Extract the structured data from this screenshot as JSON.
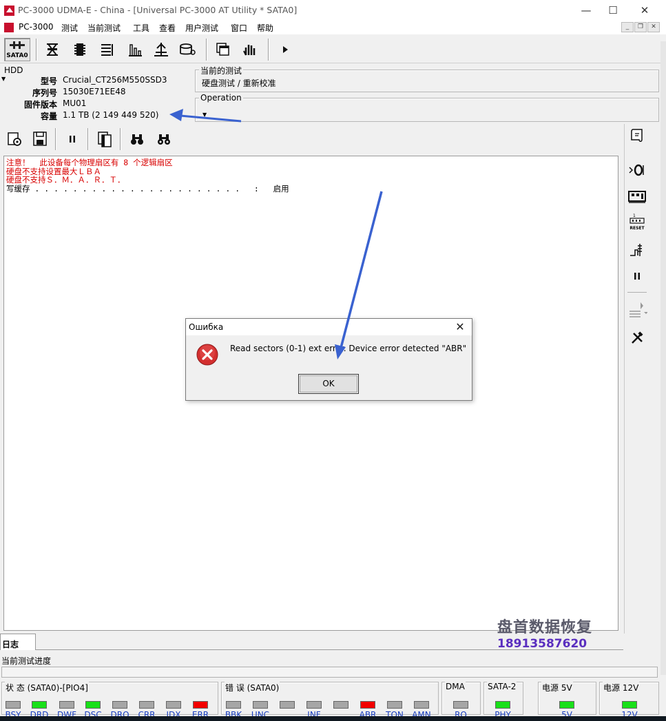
{
  "window": {
    "title": "PC-3000 UDMA-E - China - [Universal PC-3000 AT Utility * SATA0]",
    "minimize": "—",
    "maximize": "☐",
    "close": "✕"
  },
  "menu": {
    "items": [
      "PC-3000",
      "测试",
      "当前测试",
      "工具",
      "查看",
      "用户测试",
      "窗口",
      "帮助"
    ],
    "mdi_min": "_",
    "mdi_restore": "❐",
    "mdi_close": "✕"
  },
  "toolbar": {
    "sata_label": "SATA0"
  },
  "hdd": {
    "label": "HDD",
    "fields": [
      {
        "key": "型号",
        "value": "Crucial_CT256M550SSD3"
      },
      {
        "key": "序列号",
        "value": "15030E71EE48"
      },
      {
        "key": "固件版本",
        "value": "MU01"
      },
      {
        "key": "容量",
        "value": "1.1 TB (2 149 449 520)"
      }
    ]
  },
  "current_test": {
    "label": "当前的测试",
    "value": "硬盘测试 / 重新校准"
  },
  "operation": {
    "label": "Operation",
    "value": ""
  },
  "log": {
    "lines": [
      {
        "text": "注意！  此设备每个物理扇区有 8 个逻辑扇区",
        "color": "red"
      },
      {
        "text": "硬盘不支持设置最大ＬＢＡ",
        "color": "red"
      },
      {
        "text": "硬盘不支持Ｓ．Ｍ．Ａ．Ｒ．Ｔ．",
        "color": "red"
      },
      {
        "text": "写缓存 . . . . . . . . . . . . . . . . . . . . . .   :   启用",
        "color": "black"
      }
    ]
  },
  "tabs": {
    "log": "日志"
  },
  "progress": {
    "label": "当前测试进度",
    "value_fraction": 0
  },
  "status_panels": {
    "state": {
      "title": "状 态 (SATA0)-[PIO4]",
      "leds": [
        {
          "name": "BSY",
          "state": "off"
        },
        {
          "name": "DRD",
          "state": "green"
        },
        {
          "name": "DWF",
          "state": "off"
        },
        {
          "name": "DSC",
          "state": "green"
        },
        {
          "name": "DRQ",
          "state": "off"
        },
        {
          "name": "CRR",
          "state": "off"
        },
        {
          "name": "IDX",
          "state": "off"
        },
        {
          "name": "ERR",
          "state": "red"
        }
      ]
    },
    "error": {
      "title": "错 误 (SATA0)",
      "leds": [
        {
          "name": "BBK",
          "state": "off"
        },
        {
          "name": "UNC",
          "state": "off"
        },
        {
          "name": "",
          "state": "off"
        },
        {
          "name": "INF",
          "state": "off"
        },
        {
          "name": "",
          "state": "off"
        },
        {
          "name": "ABR",
          "state": "red"
        },
        {
          "name": "TON",
          "state": "off"
        },
        {
          "name": "AMN",
          "state": "off"
        }
      ]
    },
    "dma": {
      "title": "DMA",
      "led": {
        "name": "RQ",
        "state": "off"
      }
    },
    "sata2": {
      "title": "SATA-2",
      "led": {
        "name": "PHY",
        "state": "green"
      }
    },
    "power5": {
      "title": "电源 5V",
      "led": {
        "name": "5V",
        "state": "green"
      }
    },
    "power12": {
      "title": "电源 12V",
      "led": {
        "name": "12V",
        "state": "green"
      }
    }
  },
  "dialog": {
    "title": "Ошибка",
    "message": "Read sectors (0-1) ext error. Device error detected \"ABR\"",
    "ok_label": "OK",
    "icon": "error-icon"
  },
  "watermark": {
    "line1": "盘首数据恢复",
    "line2": "18913587620"
  },
  "colors": {
    "led_green": "#19e019",
    "led_red": "#f20000",
    "led_off": "#a6a6a6",
    "log_red": "#d80000",
    "arrow_blue": "#3a62d0",
    "label_blue": "#1a3fc0"
  }
}
